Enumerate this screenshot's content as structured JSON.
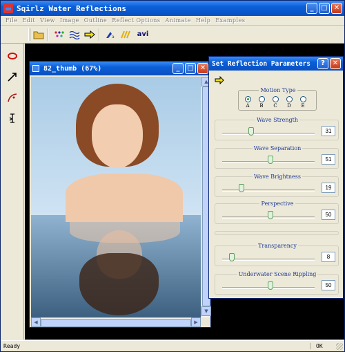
{
  "window": {
    "title": "Sqirlz Water Reflections"
  },
  "menu": [
    "File",
    "Edit",
    "View",
    "Image",
    "Outline",
    "Reflect Options",
    "Animate",
    "Help",
    "Examples"
  ],
  "toolbar": {
    "avi_label": "avi"
  },
  "status": {
    "left": "Ready",
    "right": "OK"
  },
  "image_window": {
    "title": "82_thumb   (67%)"
  },
  "dialog": {
    "title": "Set Reflection Parameters",
    "motion_type": {
      "label": "Motion Type",
      "options": [
        "A",
        "B",
        "C",
        "D",
        "E"
      ],
      "selected": "A"
    },
    "params": [
      {
        "label": "Wave Strength",
        "value": "31"
      },
      {
        "label": "Wave Separation",
        "value": "51"
      },
      {
        "label": "Wave Brightness",
        "value": "19"
      },
      {
        "label": "Perspective",
        "value": "50"
      },
      {
        "label": "Transparency",
        "value": "8"
      },
      {
        "label": "Underwater Scene Rippling",
        "value": "50"
      }
    ]
  },
  "icons": [
    "open-folder-icon",
    "dots-icon",
    "waves-icon",
    "arrow-icon",
    "tool-icon",
    "stripes-icon",
    "ellipse-icon",
    "line-arrow-icon",
    "curve-icon",
    "cursor-icon"
  ]
}
